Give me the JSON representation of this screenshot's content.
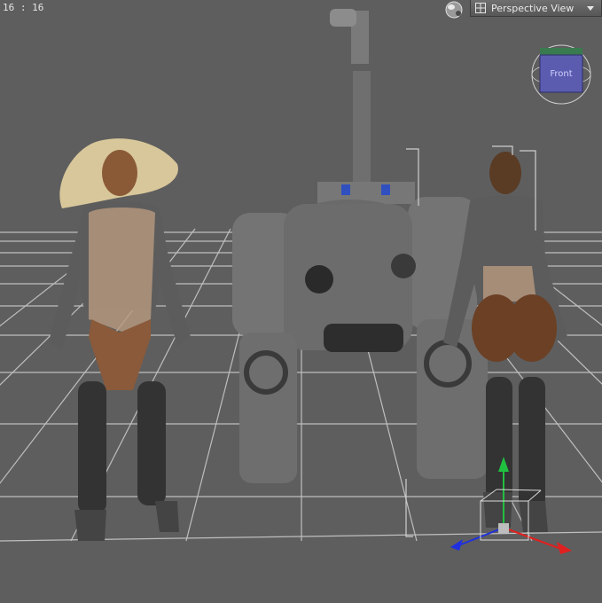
{
  "viewport": {
    "aspect_ratio": "16 : 16",
    "view_menu": {
      "label": "Perspective View"
    },
    "view_cube": {
      "face_label": "Front"
    }
  },
  "colors": {
    "background": "#5e5e5e",
    "grid": "#c9c9c9",
    "cube_face": "#5b5bb0",
    "gizmo_x": "#e02020",
    "gizmo_y": "#20c040",
    "gizmo_z": "#2030e0"
  },
  "icons": [
    "perspective-view-icon",
    "chevron-down-icon",
    "view-sphere-icon"
  ]
}
